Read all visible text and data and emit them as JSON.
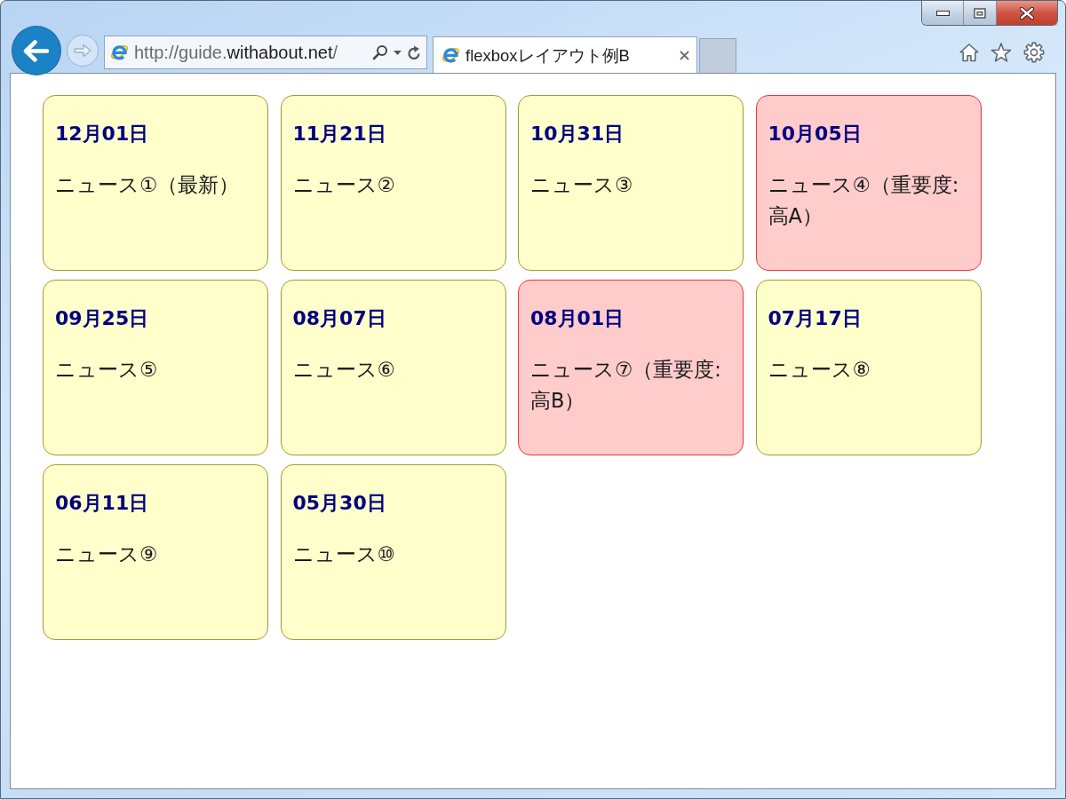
{
  "browser": {
    "address": {
      "scheme_host": "http://guide.",
      "domain": "withabout.net",
      "path": "/"
    },
    "tabs": [
      {
        "title": "flexboxレイアウト例B",
        "selected": true
      }
    ]
  },
  "cards": [
    {
      "date": "12月01日",
      "text": "ニュース①（最新）",
      "important": false
    },
    {
      "date": "11月21日",
      "text": "ニュース②",
      "important": false
    },
    {
      "date": "10月31日",
      "text": "ニュース③",
      "important": false
    },
    {
      "date": "10月05日",
      "text": "ニュース④（重要度:高A）",
      "important": true
    },
    {
      "date": "09月25日",
      "text": "ニュース⑤",
      "important": false
    },
    {
      "date": "08月07日",
      "text": "ニュース⑥",
      "important": false
    },
    {
      "date": "08月01日",
      "text": "ニュース⑦（重要度:高B）",
      "important": true
    },
    {
      "date": "07月17日",
      "text": "ニュース⑧",
      "important": false
    },
    {
      "date": "06月11日",
      "text": "ニュース⑨",
      "important": false
    },
    {
      "date": "05月30日",
      "text": "ニュース⑩",
      "important": false
    }
  ]
}
